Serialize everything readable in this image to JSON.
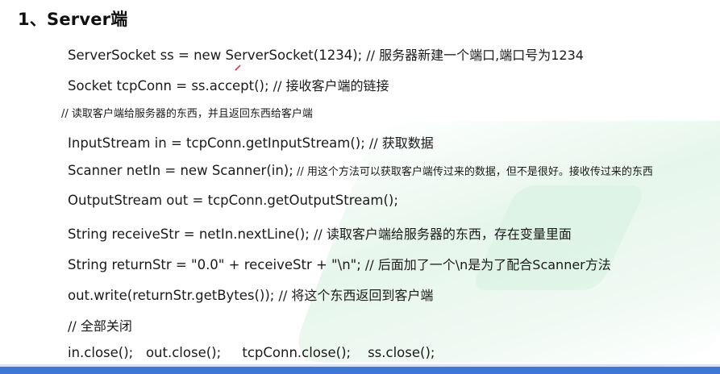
{
  "heading": "1、Server端",
  "lines": [
    {
      "code": "ServerSocket ss = new ServerSocket(1234);",
      "comment": " // 服务器新建一个端口,端口号为1234"
    },
    {
      "code": "Socket tcpConn = ss.accept();",
      "comment": " // 接收客户端的链接"
    },
    {
      "code": "",
      "comment": "// 读取客户端给服务器的东西，并且返回东西给客户端"
    },
    {
      "code": "InputStream in = tcpConn.getInputStream();",
      "comment": " // 获取数据"
    },
    {
      "code": "Scanner netIn = new Scanner(in);",
      "comment": " // 用这个方法可以获取客户端传过来的数据，但不是很好。接收传过来的东西"
    },
    {
      "code": "OutputStream out = tcpConn.getOutputStream();",
      "comment": ""
    },
    {
      "code": "String receiveStr = netIn.nextLine();",
      "comment": " // 读取客户端给服务器的东西，存在变量里面"
    },
    {
      "code": "String returnStr = \"0.0\" + receiveStr + \"\\n\";",
      "comment": " // 后面加了一个\\n是为了配合Scanner方法"
    },
    {
      "code": "out.write(returnStr.getBytes());",
      "comment": " // 将这个东西返回到客户端"
    },
    {
      "code": "",
      "comment": "// 全部关闭"
    },
    {
      "code": "in.close();   out.close();     tcpConn.close();    ss.close();",
      "comment": ""
    }
  ]
}
